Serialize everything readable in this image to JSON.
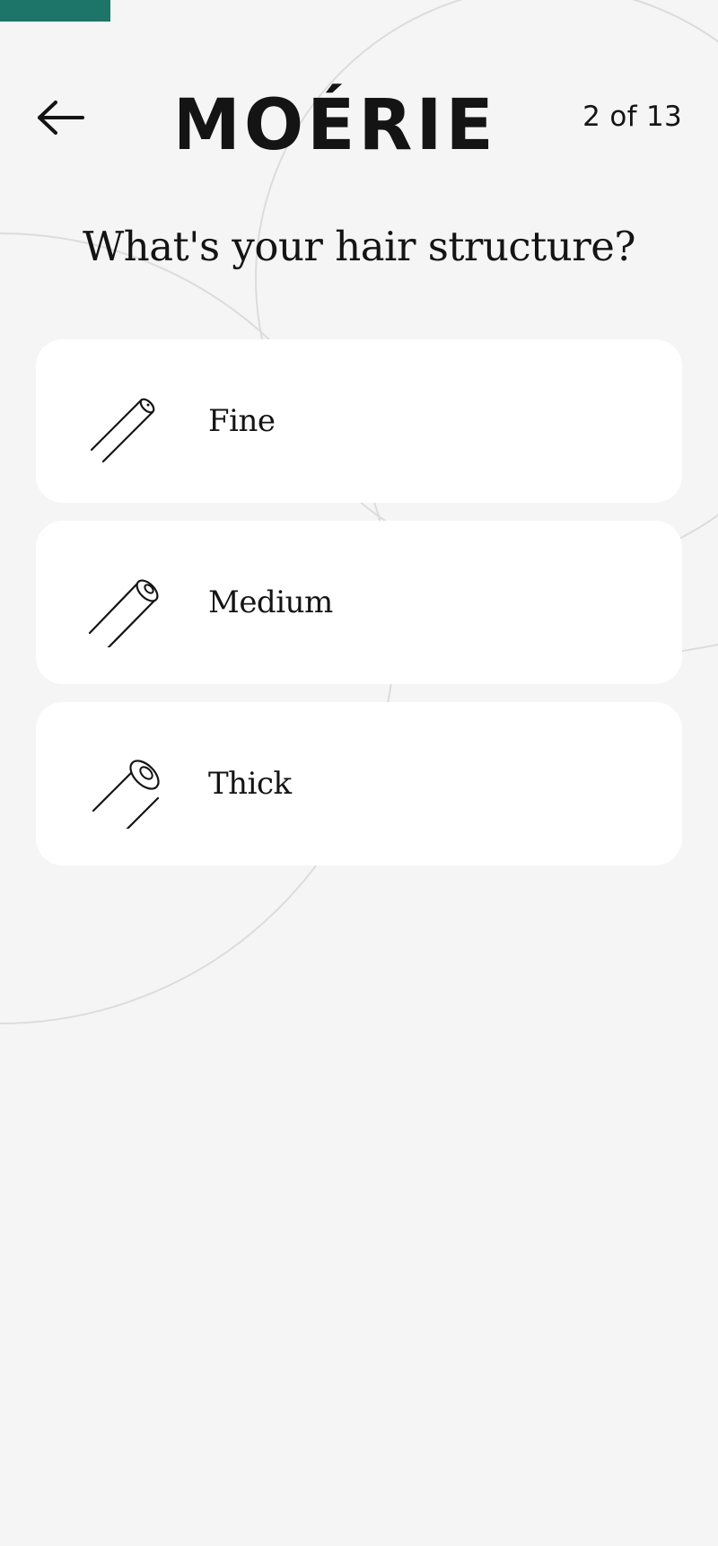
{
  "header": {
    "brand": "MOÉRIE",
    "step_counter": "2 of 13",
    "back_icon": "arrow-left-icon"
  },
  "progress": {
    "current": 2,
    "total": 13,
    "color": "#1d7468"
  },
  "question": {
    "title": "What's your hair structure?"
  },
  "options": [
    {
      "label": "Fine",
      "icon": "fine-hair-strand-icon"
    },
    {
      "label": "Medium",
      "icon": "medium-hair-strand-icon"
    },
    {
      "label": "Thick",
      "icon": "thick-hair-strand-icon"
    }
  ],
  "colors": {
    "background": "#f5f5f5",
    "card": "#ffffff",
    "text": "#141414",
    "accent": "#1d7468"
  }
}
